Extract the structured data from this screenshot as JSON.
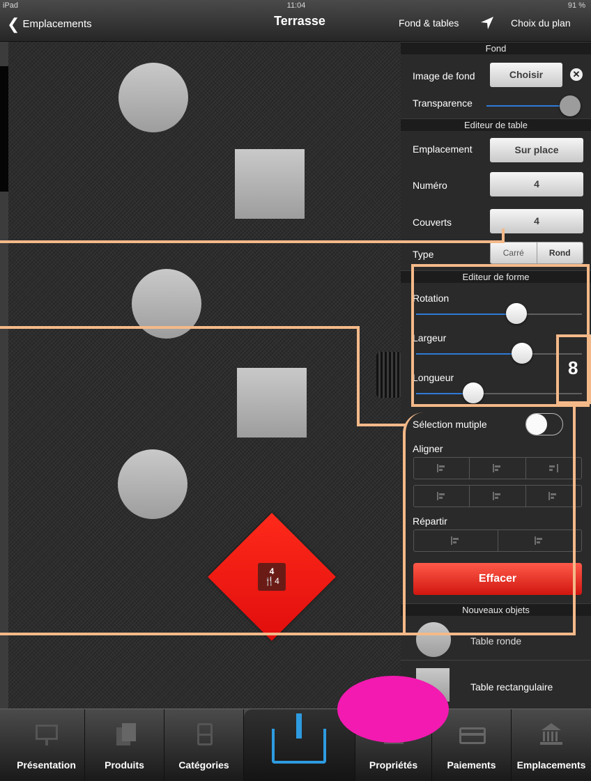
{
  "statusbar": {
    "carrier": "iPad",
    "time": "11:04",
    "battery": "91 %"
  },
  "navbar": {
    "back_label": "Emplacements",
    "title": "Terrasse",
    "fond_tables": "Fond & tables",
    "choix_plan": "Choix du plan"
  },
  "canvas": {
    "table_number": "4",
    "table_covers": "4"
  },
  "panel": {
    "fond": {
      "header": "Fond",
      "image_label": "Image de fond",
      "choose_button": "Choisir",
      "transparency_label": "Transparence",
      "transparency_value": 0.93
    },
    "table_editor": {
      "header": "Editeur de table",
      "emplacement_label": "Emplacement",
      "emplacement_value": "Sur place",
      "numero_label": "Numéro",
      "numero_value": "4",
      "couverts_label": "Couverts",
      "couverts_value": "4",
      "type_label": "Type",
      "type_options": [
        "Carré",
        "Rond"
      ],
      "type_selected": "Carré"
    },
    "shape_editor": {
      "header": "Editeur de forme",
      "rotation_label": "Rotation",
      "rotation_value": 0.6,
      "largeur_label": "Largeur",
      "largeur_value": 0.64,
      "longueur_label": "Longueur",
      "longueur_value": 0.33
    },
    "multi_select_label": "Sélection mutiple",
    "multi_select_on": false,
    "align_label": "Aligner",
    "distribute_label": "Répartir",
    "delete_button": "Effacer",
    "new_objects": {
      "header": "Nouveaux objets",
      "round_table": "Table ronde",
      "rect_table": "Table rectangulaire"
    }
  },
  "tabbar": {
    "tabs": [
      {
        "label": "Présentation",
        "icon": "presentation-icon"
      },
      {
        "label": "Produits",
        "icon": "products-icon"
      },
      {
        "label": "Catégories",
        "icon": "cabinet-icon"
      },
      {
        "label": "",
        "icon": "power-icon"
      },
      {
        "label": "Propriétés",
        "icon": "properties-icon"
      },
      {
        "label": "Paiements",
        "icon": "payment-card-icon"
      },
      {
        "label": "Emplacements",
        "icon": "bank-building-icon"
      }
    ]
  },
  "colors": {
    "annotation": "#f4b989",
    "table_selected": "#ff1a10",
    "highlight_blob": "#f21ab0",
    "slider_fill": "#2f7ad8"
  }
}
